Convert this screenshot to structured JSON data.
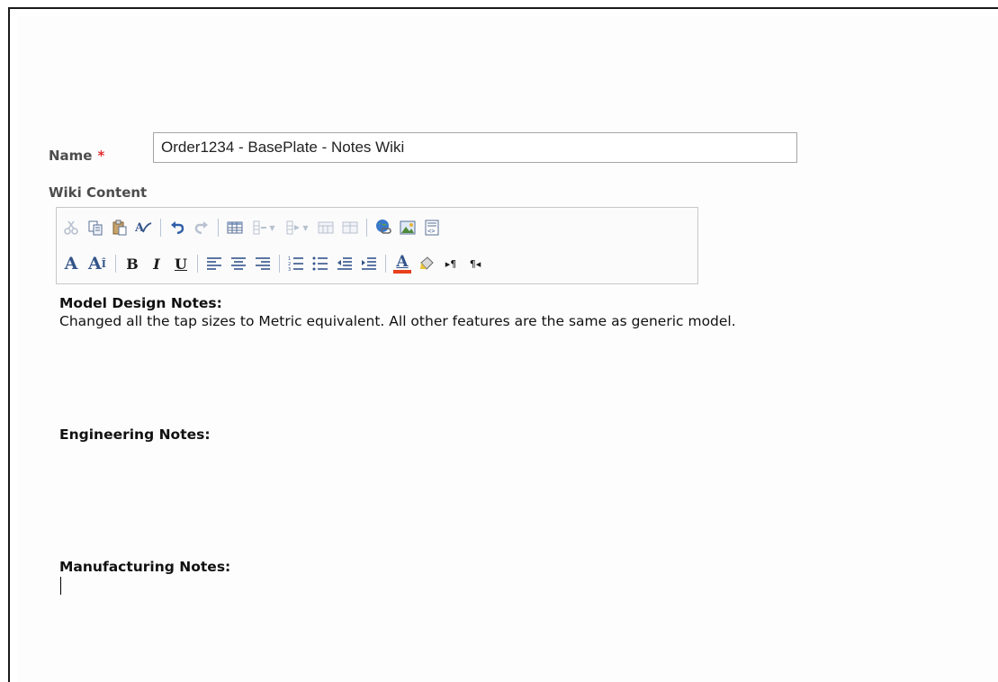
{
  "form": {
    "name_label": "Name",
    "name_required": "*",
    "name_value": "Order1234 - BasePlate - Notes Wiki",
    "wiki_label": "Wiki Content"
  },
  "toolbar": {
    "row1": [
      "cut-icon",
      "copy-icon",
      "paste-icon",
      "spellcheck-icon",
      "undo-icon",
      "redo-icon",
      "insert-table-icon",
      "insert-row-icon",
      "insert-column-icon",
      "merge-cells-icon",
      "split-cells-icon",
      "insert-link-icon",
      "insert-image-icon",
      "html-source-icon"
    ],
    "row2": [
      "font-icon",
      "font-size-icon",
      "bold-icon",
      "italic-icon",
      "underline-icon",
      "align-left-icon",
      "align-center-icon",
      "align-right-icon",
      "numbered-list-icon",
      "bullet-list-icon",
      "decrease-indent-icon",
      "increase-indent-icon",
      "text-color-icon",
      "highlight-color-icon",
      "ltr-icon",
      "rtl-icon"
    ],
    "accent_red": "#e8401c",
    "accent_blue": "#34558b"
  },
  "content": {
    "model_heading": "Model Design Notes:",
    "model_text": "Changed all the tap sizes to Metric equivalent. All other features are the same as generic model.",
    "engineering_heading": "Engineering Notes:",
    "manufacturing_heading": "Manufacturing Notes:"
  }
}
